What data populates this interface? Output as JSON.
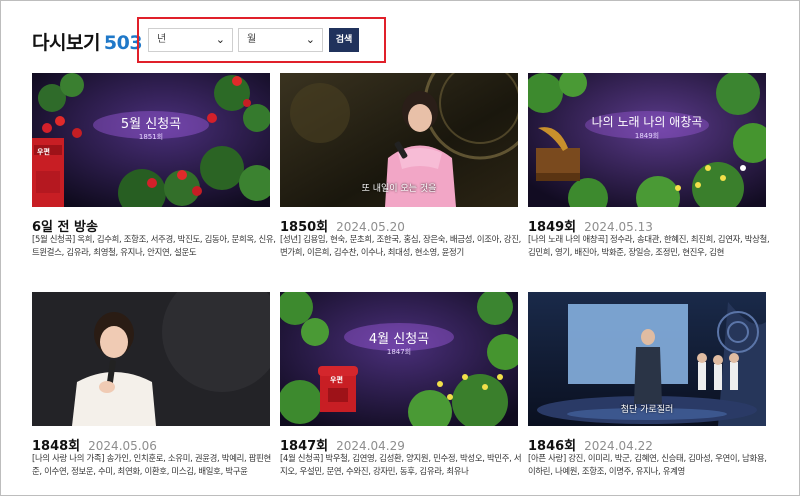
{
  "header": {
    "title": "다시보기",
    "count": "503"
  },
  "filters": {
    "year_label": "년",
    "month_label": "월",
    "search_label": "검색"
  },
  "thumb_texts": {
    "c1_banner": "5월 신청곡",
    "c1_sub": "1851회",
    "c2_caption": "또 내일이 오는 것을",
    "c3_banner": "나의 노래 나의 애창곡",
    "c3_sub": "1849회",
    "c5_banner": "4월 신청곡",
    "c5_sub": "1847회",
    "c6_caption": "첨단 가로질러",
    "post_label": "우편"
  },
  "episodes": [
    {
      "title": "6일 전 방송",
      "date": "",
      "desc": "[5월 신청곡] 옥희, 김수희, 조항조, 서주경, 박진도, 김동아, 문희옥, 신유, 트윈걸스, 김유라, 최영철, 유지나, 안지연, 설운도"
    },
    {
      "title": "1850회",
      "date": "2024.05.20",
      "desc": "[성년] 김용임, 현숙, 문초희, 조한국, 홍심, 장은숙, 배금성, 이조아, 강진, 변가희, 이은희, 김수찬, 이수나, 최대성, 현소영, 윤정기"
    },
    {
      "title": "1849회",
      "date": "2024.05.13",
      "desc": "[나의 노래 나의 애창곡] 정수라, 송대관, 한혜진, 최진희, 김연자, 박상철, 김민희, 영기, 배진아, 박화준, 장일승, 조정민, 현진우, 김현"
    },
    {
      "title": "1848회",
      "date": "2024.05.06",
      "desc": "[나의 사랑 나의 가족] 송가인, 인치훈로, 소유미, 권윤경, 박예리, 팝핀현준, 이수연, 정보운, 수미, 최연화, 이환호, 미스김, 배일호, 박구윤"
    },
    {
      "title": "1847회",
      "date": "2024.04.29",
      "desc": "[4월 신청곡] 박우철, 김연영, 김성환, 양지원, 민수정, 박성오, 박민주, 서지오, 우설민, 문연, 수와진, 강자민, 동후, 김유라, 최유나"
    },
    {
      "title": "1846회",
      "date": "2024.04.22",
      "desc": "[아픈 사랑] 강진, 이미리, 박군, 김혜연, 신승태, 김마성, 우연이, 남화용, 이하린, 나예원, 조항조, 이명주, 유지나, 유계영"
    }
  ],
  "colors": {
    "accent_count": "#1f78c8",
    "highlight_box": "#e0202a",
    "search_button": "#20325c"
  }
}
